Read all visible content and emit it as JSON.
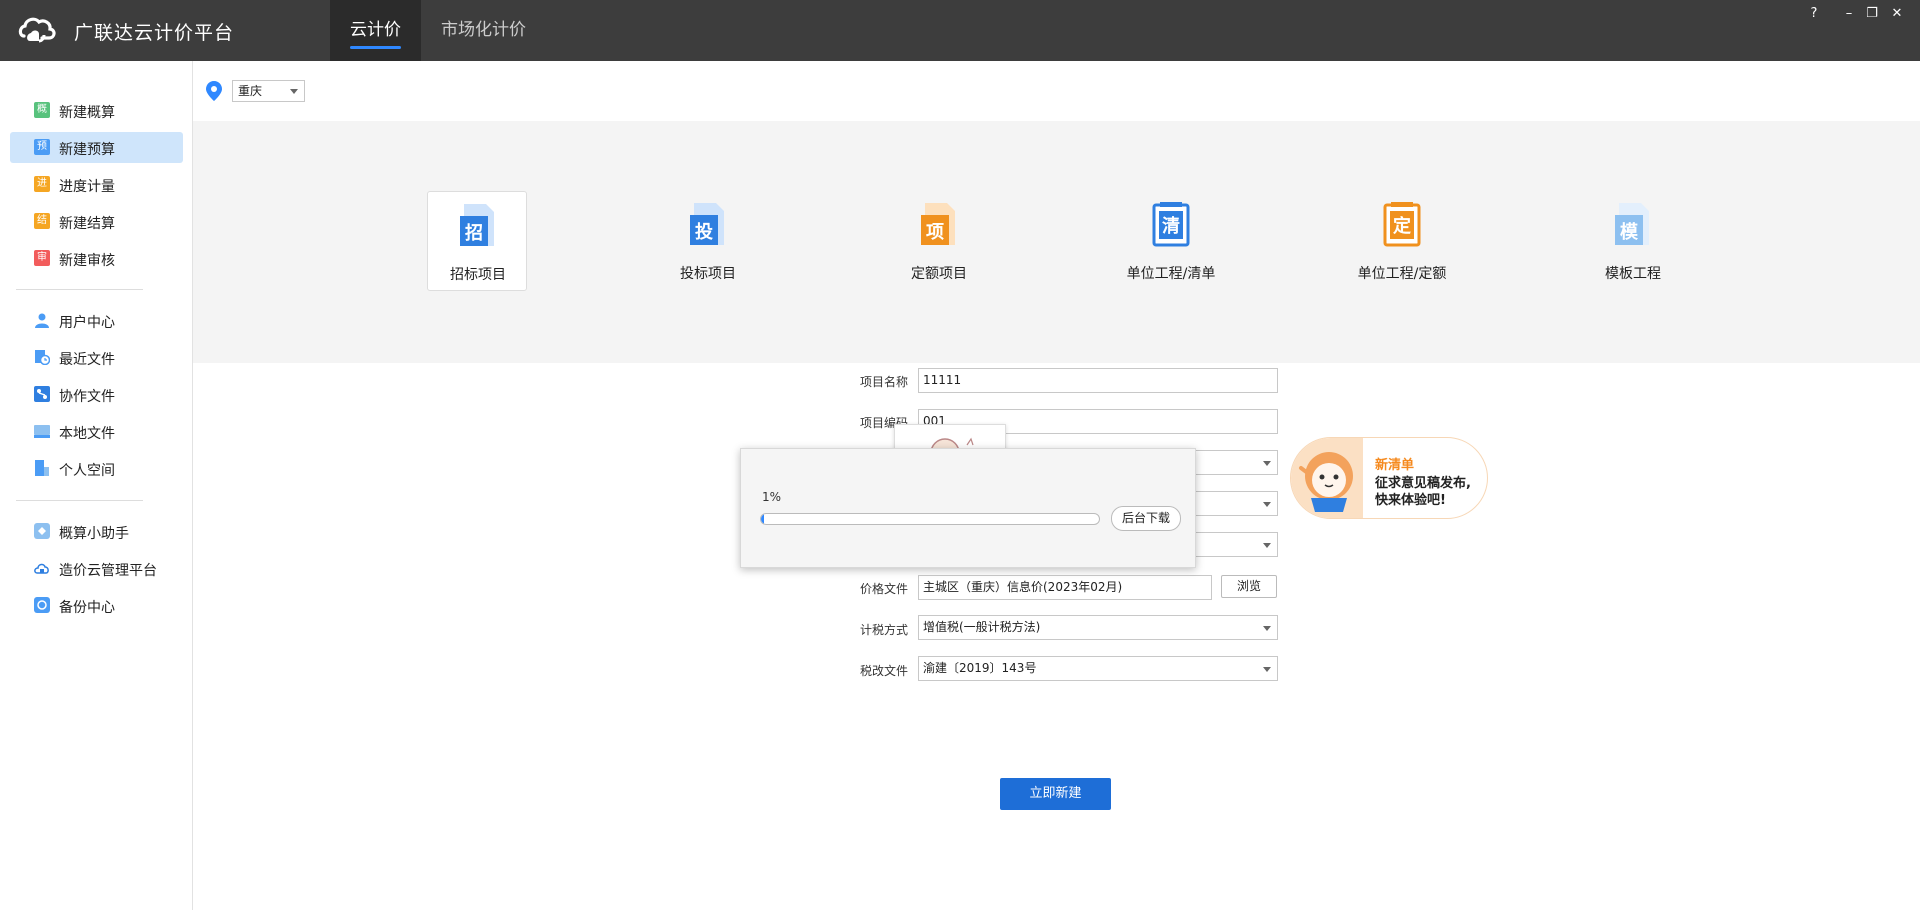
{
  "app": {
    "title": "广联达云计价平台",
    "tabs": [
      {
        "label": "云计价",
        "active": true
      },
      {
        "label": "市场化计价",
        "active": false
      }
    ],
    "window_controls": [
      "?",
      "–",
      "❐",
      "✕"
    ]
  },
  "sidebar": {
    "group1": [
      {
        "label": "新建概算",
        "icon_char": "概",
        "color": "#58c27d"
      },
      {
        "label": "新建预算",
        "icon_char": "预",
        "color": "#4b9cf5",
        "active": true
      },
      {
        "label": "进度计量",
        "icon_char": "进",
        "color": "#f5a623"
      },
      {
        "label": "新建结算",
        "icon_char": "结",
        "color": "#f5a623"
      },
      {
        "label": "新建审核",
        "icon_char": "审",
        "color": "#f25c5c"
      }
    ],
    "group2": [
      {
        "label": "用户中心"
      },
      {
        "label": "最近文件"
      },
      {
        "label": "协作文件"
      },
      {
        "label": "本地文件"
      },
      {
        "label": "个人空间"
      }
    ],
    "group3": [
      {
        "label": "概算小助手"
      },
      {
        "label": "造价云管理平台"
      },
      {
        "label": "备份中心"
      }
    ]
  },
  "location": {
    "value": "重庆"
  },
  "project_types": [
    {
      "label": "招标项目",
      "glyph": "招",
      "color": "#2f7fe0",
      "selected": true
    },
    {
      "label": "投标项目",
      "glyph": "投",
      "color": "#2f7fe0"
    },
    {
      "label": "定额项目",
      "glyph": "项",
      "color": "#f0911e"
    },
    {
      "label": "单位工程/清单",
      "glyph": "清",
      "color": "#2f7fe0"
    },
    {
      "label": "单位工程/定额",
      "glyph": "定",
      "color": "#f0911e"
    },
    {
      "label": "模板工程",
      "glyph": "模",
      "color": "#8dc0f0"
    }
  ],
  "form": {
    "project_name_label": "项目名称",
    "project_name_value": "11111",
    "project_code_label": "项目编码",
    "project_code_value": "001",
    "price_file_label": "价格文件",
    "price_file_value": "主城区（重庆）信息价(2023年02月)",
    "browse_label": "浏览",
    "tax_method_label": "计税方式",
    "tax_method_value": "增值税(一般计税方法)",
    "tax_doc_label": "税改文件",
    "tax_doc_value": "渝建〔2019〕143号",
    "create_button": "立即新建"
  },
  "progress": {
    "percent_text": "1%",
    "value": 0.01,
    "background_button": "后台下载"
  },
  "promo": {
    "title": "新清单",
    "line1": "征求意见稿发布,",
    "line2": "快来体验吧!"
  }
}
